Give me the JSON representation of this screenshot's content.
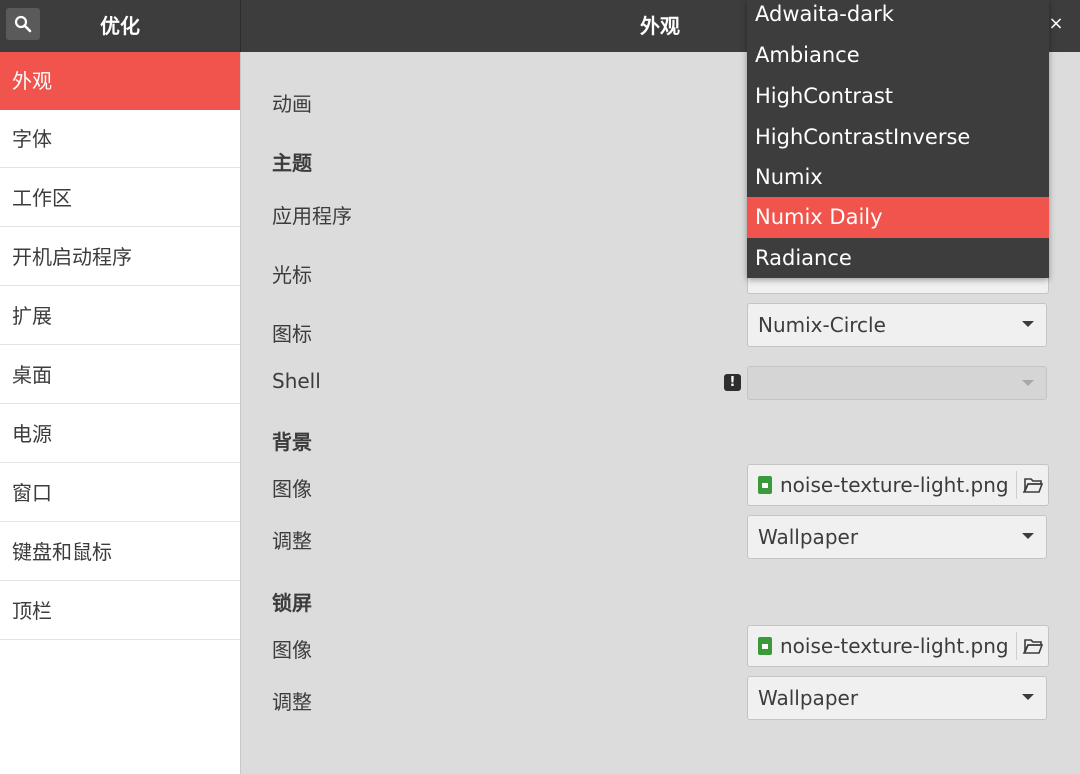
{
  "header": {
    "app_title": "优化",
    "page_title": "外观",
    "close": "×"
  },
  "sidebar": {
    "items": [
      {
        "label": "外观",
        "active": true
      },
      {
        "label": "字体"
      },
      {
        "label": "工作区"
      },
      {
        "label": "开机启动程序"
      },
      {
        "label": "扩展"
      },
      {
        "label": "桌面"
      },
      {
        "label": "电源"
      },
      {
        "label": "窗口"
      },
      {
        "label": "键盘和鼠标"
      },
      {
        "label": "顶栏"
      }
    ]
  },
  "content": {
    "animation_label": "动画",
    "themes_section": "主题",
    "applications_label": "应用程序",
    "cursor_label": "光标",
    "icons_label": "图标",
    "icons_value": "Numix-Circle",
    "shell_label": "Shell",
    "shell_value": "",
    "warning_glyph": "!",
    "background_section": "背景",
    "bg_image_label": "图像",
    "bg_image_value": "noise-texture-light.png",
    "bg_adjust_label": "调整",
    "bg_adjust_value": "Wallpaper",
    "lock_section": "锁屏",
    "lock_image_label": "图像",
    "lock_image_value": "noise-texture-light.png",
    "lock_adjust_label": "调整",
    "lock_adjust_value": "Wallpaper"
  },
  "dropdown": {
    "options": [
      "Adwaita-dark",
      "Ambiance",
      "HighContrast",
      "HighContrastInverse",
      "Numix",
      "Numix Daily",
      "Radiance"
    ],
    "selected": "Numix Daily"
  },
  "colors": {
    "accent": "#f0544c",
    "headerbar": "#3d3d3d",
    "content_bg": "#dcdcdc"
  }
}
